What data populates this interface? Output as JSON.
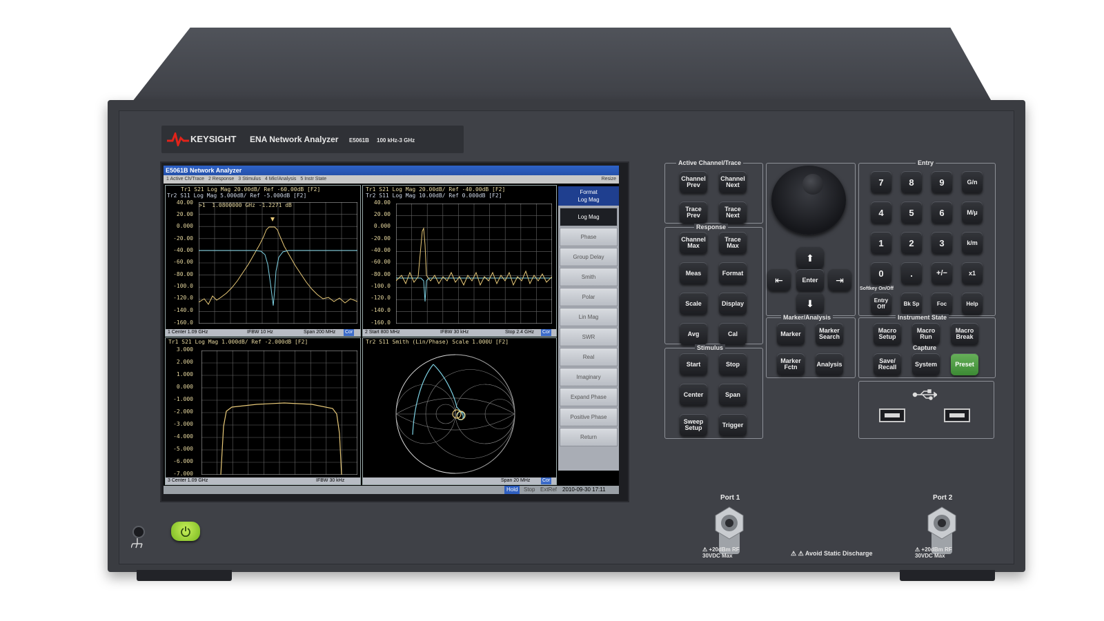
{
  "brand": {
    "name": "KEYSIGHT",
    "product": "ENA Network Analyzer",
    "model": "E5061B",
    "range": "100 kHz-3 GHz"
  },
  "screen": {
    "title": "E5061B Network Analyzer",
    "menu": [
      "1 Active Ch/Trace",
      "2 Response",
      "3 Stimulus",
      "4 Mkr/Analysis",
      "5 Instr State"
    ],
    "resize": "Resize",
    "windows": [
      {
        "header1": "Tr1 S21 Log Mag 20.00dB/ Ref -60.00dB [F2]",
        "header2": "Tr2 S11 Log Mag 5.000dB/ Ref -5.000dB [F2]",
        "marker": ">1  1.0800000 GHz -1.2271 dB",
        "yticks": [
          "40.00",
          "20.00",
          "0.000",
          "-20.00",
          "-40.00",
          "-60.00",
          "-80.00",
          "-100.0",
          "-120.0",
          "-140.0",
          "-160.0"
        ],
        "footer_left": "1  Center 1.09 GHz",
        "footer_mid": "IFBW 10 Hz",
        "footer_right": "Span 200 MHz",
        "cor": "Cor"
      },
      {
        "header1": "Tr1 S21 Log Mag 20.00dB/ Ref -40.00dB [F2]",
        "header2": "Tr2 S11 Log Mag 10.00dB/ Ref 0.000dB [F2]",
        "yticks": [
          "40.00",
          "20.00",
          "0.000",
          "-20.00",
          "-40.00",
          "-60.00",
          "-80.00",
          "-100.0",
          "-120.0",
          "-140.0",
          "-160.0"
        ],
        "footer_left": "2  Start 800 MHz",
        "footer_mid": "IFBW 30 kHz",
        "footer_right": "Stop 2.4 GHz",
        "cor": "Cor"
      },
      {
        "header1": "Tr1 S21 Log Mag 1.000dB/ Ref -2.000dB [F2]",
        "yticks": [
          "3.000",
          "2.000",
          "1.000",
          "0.000",
          "-1.000",
          "-2.000",
          "-3.000",
          "-4.000",
          "-5.000",
          "-6.000",
          "-7.000"
        ],
        "footer_left": "3  Center 1.09 GHz",
        "footer_mid": "IFBW 30 kHz",
        "footer_right": "Span 20 MHz",
        "cor": "Cor"
      },
      {
        "header1": "Tr2 S11 Smith (Lin/Phase) Scale 1.000U [F2]"
      }
    ],
    "softkeys": {
      "title": "Format",
      "value": "Log Mag",
      "items": [
        "Log Mag",
        "Phase",
        "Group Delay",
        "Smith",
        "Polar",
        "Lin Mag",
        "SWR",
        "Real",
        "Imaginary",
        "Expand Phase",
        "Positive Phase",
        "Return"
      ]
    },
    "status": {
      "hold": "Hold",
      "stop": "Stop",
      "extref": "ExtRef",
      "datetime": "2010-09-30 17:11"
    }
  },
  "panel": {
    "active": {
      "label": "Active Channel/Trace",
      "keys": [
        "Channel Prev",
        "Channel Next",
        "Trace Prev",
        "Trace Next"
      ]
    },
    "response": {
      "label": "Response",
      "keys": [
        "Channel Max",
        "Trace Max",
        "Meas",
        "Format",
        "Scale",
        "Display",
        "Avg",
        "Cal"
      ]
    },
    "stimulus": {
      "label": "Stimulus",
      "keys": [
        "Start",
        "Stop",
        "Center",
        "Span",
        "Sweep Setup",
        "Trigger"
      ]
    },
    "nav": {
      "enter": "Enter",
      "up": "⬆",
      "down": "⬇",
      "left": "⇤",
      "right": "⇥"
    },
    "marker": {
      "label": "Marker/Analysis",
      "keys": [
        "Marker",
        "Marker Search",
        "Marker Fctn",
        "Analysis"
      ]
    },
    "entry": {
      "label": "Entry",
      "keys": [
        "7",
        "8",
        "9",
        "G/n",
        "4",
        "5",
        "6",
        "M/μ",
        "1",
        "2",
        "3",
        "k/m",
        "0",
        ".",
        "+/−",
        "x1"
      ],
      "softkey_label": "Softkey On/Off",
      "keys2": [
        "Entry Off",
        "Bk Sp",
        "Foc",
        "Help"
      ]
    },
    "instrument": {
      "label": "Instrument State",
      "keys": [
        "Macro Setup",
        "Macro Run",
        "Macro Break"
      ],
      "capture": "Capture",
      "keys2": [
        "Save/ Recall",
        "System",
        "Preset"
      ]
    },
    "usb_icon": "usb-icon",
    "ports": {
      "port1": "Port 1",
      "port2": "Port 2",
      "warning1": "+20dBm RF 30VDC Max",
      "warning2": "+20dBm RF 30VDC Max",
      "static": "Avoid Static Discharge"
    },
    "power_icon": "power-icon",
    "ground_icon": "ground-icon"
  }
}
